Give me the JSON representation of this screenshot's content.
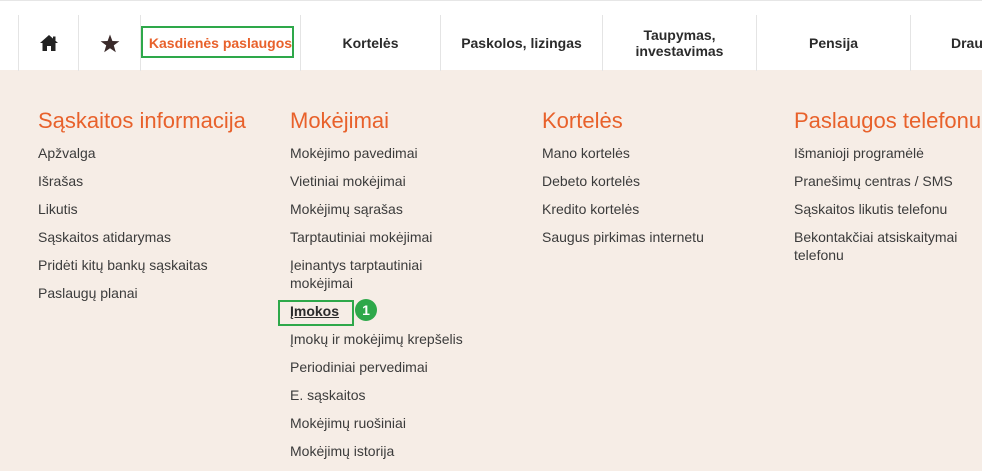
{
  "topnav": {
    "items": [
      {
        "icon": "home-icon"
      },
      {
        "icon": "star-icon"
      },
      {
        "label": "Kasdienės paslaugos"
      },
      {
        "label": "Kortelės"
      },
      {
        "label": "Paskolos, lizingas"
      },
      {
        "label": "Taupymas, investavimas"
      },
      {
        "label": "Pensija"
      },
      {
        "label": "Drau"
      }
    ]
  },
  "menu": {
    "columns": [
      {
        "title": "Sąskaitos informacija",
        "items": [
          "Apžvalga",
          "Išrašas",
          "Likutis",
          "Sąskaitos atidarymas",
          "Pridėti kitų bankų sąskaitas",
          "Paslaugų planai"
        ]
      },
      {
        "title": "Mokėjimai",
        "items": [
          "Mokėjimo pavedimai",
          "Vietiniai mokėjimai",
          "Mokėjimų sąrašas",
          "Tarptautiniai mokėjimai",
          "Įeinantys tarptautiniai mokėjimai",
          "Įmokos",
          "Įmokų ir mokėjimų krepšelis",
          "Periodiniai pervedimai",
          "E. sąskaitos",
          "Mokėjimų ruošiniai",
          "Mokėjimų istorija"
        ]
      },
      {
        "title": "Kortelės",
        "items": [
          "Mano kortelės",
          "Debeto kortelės",
          "Kredito kortelės",
          "Saugus pirkimas internetu"
        ]
      },
      {
        "title": "Paslaugos telefonu",
        "items": [
          "Išmanioji programėlė",
          "Pranešimų centras / SMS",
          "Sąskaitos likutis telefonu",
          "Bekontakčiai atsiskaitymai telefonu"
        ]
      }
    ]
  },
  "annotation": {
    "badge": "1"
  },
  "colors": {
    "accent": "#e8612b",
    "highlight": "#2ea84a",
    "menu_bg": "#f6ede6"
  }
}
